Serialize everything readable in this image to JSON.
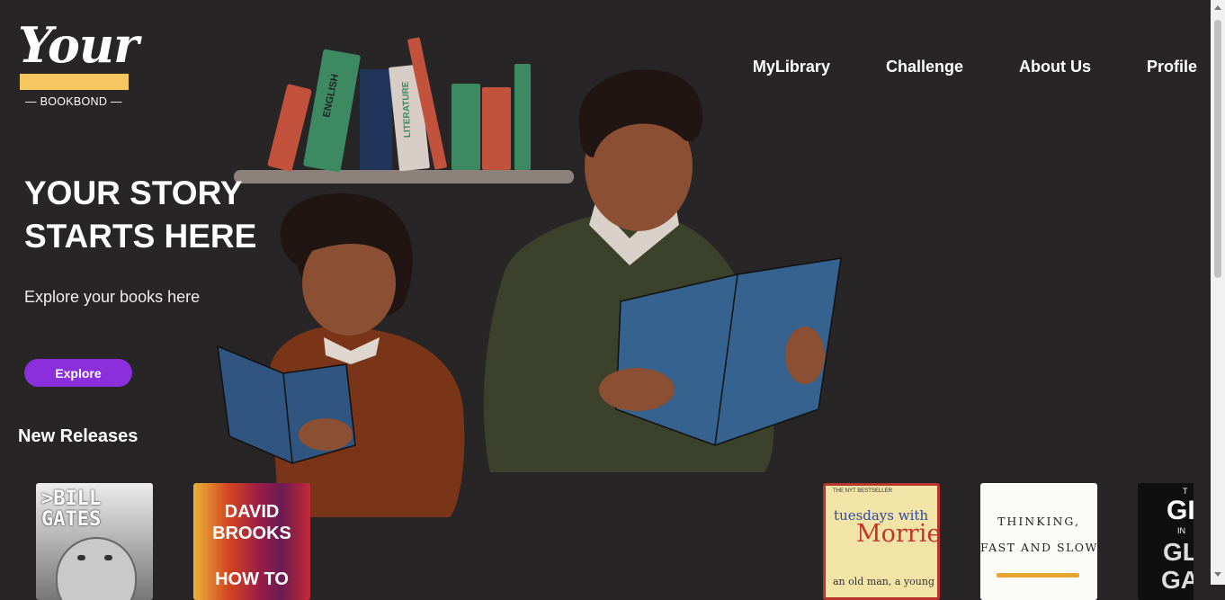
{
  "logo": {
    "script": "Your",
    "subtitle": "— BOOKBOND —"
  },
  "nav": {
    "items": [
      "MyLibrary",
      "Challenge",
      "About Us",
      "Profile"
    ]
  },
  "hero": {
    "title": "YOUR STORY STARTS HERE",
    "subtitle": "Explore your books here",
    "button_label": "Explore"
  },
  "illustration": {
    "spine_labels": [
      "ENGLISH",
      "LITERATURE"
    ]
  },
  "new_releases": {
    "title": "New Releases",
    "books": [
      {
        "lines": [
          ">BILL",
          "GATES"
        ]
      },
      {
        "lines": [
          "DAVID",
          "BROOKS",
          "HOW TO"
        ]
      },
      {
        "lines": [
          "THE NYT BESTSELLER",
          "tuesdays with",
          "Morrie",
          "an old man, a young man,"
        ]
      },
      {
        "lines": [
          "THINKING,",
          "FAST AND SLOW"
        ]
      },
      {
        "lines": [
          "T",
          "GI",
          "IN",
          "GLA",
          "GA"
        ]
      }
    ]
  },
  "colors": {
    "background": "#272526",
    "accent": "#8b2fdd",
    "logo_bar": "#f6c760"
  }
}
